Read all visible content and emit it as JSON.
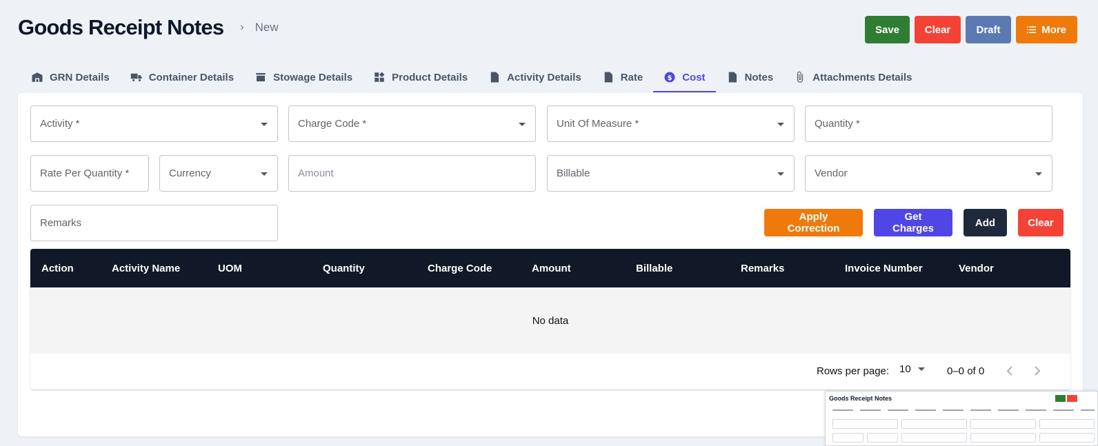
{
  "header": {
    "title": "Goods Receipt Notes",
    "breadcrumb_sep": "›",
    "breadcrumb_current": "New"
  },
  "actions": {
    "save": "Save",
    "clear": "Clear",
    "draft": "Draft",
    "more": "More"
  },
  "tabs": [
    {
      "label": "GRN Details",
      "icon": "warehouse-icon"
    },
    {
      "label": "Container Details",
      "icon": "truck-icon"
    },
    {
      "label": "Stowage Details",
      "icon": "store-icon"
    },
    {
      "label": "Product Details",
      "icon": "widgets-icon"
    },
    {
      "label": "Activity Details",
      "icon": "file-chart-icon"
    },
    {
      "label": "Rate",
      "icon": "invoice-icon"
    },
    {
      "label": "Cost",
      "icon": "dollar-circle-icon",
      "active": true
    },
    {
      "label": "Notes",
      "icon": "document-icon"
    },
    {
      "label": "Attachments Details",
      "icon": "paperclip-icon"
    }
  ],
  "form": {
    "activity": "Activity *",
    "charge_code": "Charge Code *",
    "uom": "Unit Of Measure *",
    "quantity": "Quantity *",
    "rate_per_quantity": "Rate Per Quantity *",
    "currency": "Currency",
    "amount": "Amount",
    "billable": "Billable",
    "vendor": "Vendor",
    "remarks": "Remarks"
  },
  "form_actions": {
    "apply_correction": "Apply Correction",
    "get_charges": "Get Charges",
    "add": "Add",
    "clear": "Clear"
  },
  "table": {
    "columns": [
      "Action",
      "Activity Name",
      "UOM",
      "Quantity",
      "Charge Code",
      "Amount",
      "Billable",
      "Remarks",
      "Invoice Number",
      "Vendor"
    ],
    "empty_text": "No data",
    "rows_per_page_label": "Rows per page:",
    "rows_per_page": "10",
    "range": "0–0 of 0"
  },
  "preview": {
    "title": "Goods Receipt Notes"
  },
  "colors": {
    "accent": "#4f46e5",
    "save": "#2e7d32",
    "clear": "#f44336",
    "draft": "#5b7ab4",
    "more": "#f0790c",
    "table_header": "#111827"
  }
}
